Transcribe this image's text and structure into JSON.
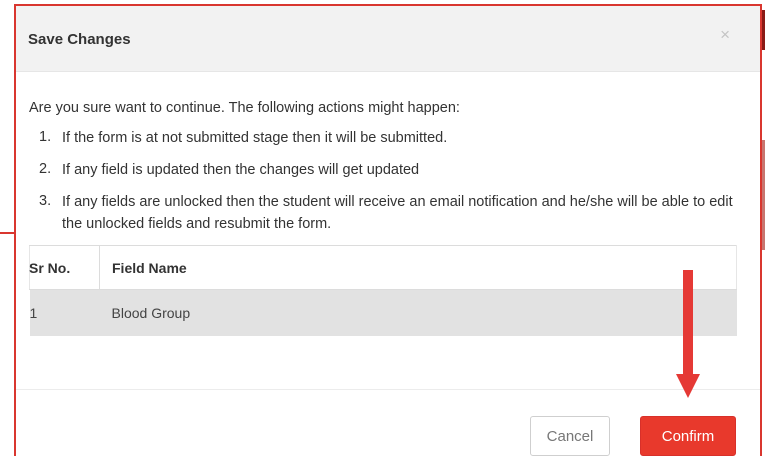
{
  "dialog": {
    "title": "Save Changes",
    "close_symbol": "×",
    "intro": "Are you sure want to continue. The following actions might happen:",
    "actions": [
      {
        "num": "1.",
        "text": "If the form is at not submitted stage then it will be submitted."
      },
      {
        "num": "2.",
        "text": "If any field is updated then the changes will get updated"
      },
      {
        "num": "3.",
        "text": "If any fields are unlocked then the student will receive an email notification and he/she will be able to edit the unlocked fields and resubmit the form."
      }
    ],
    "table": {
      "headers": [
        "Sr No.",
        "Field Name"
      ],
      "rows": [
        {
          "sr": "1",
          "field": "Blood Group"
        }
      ]
    },
    "buttons": {
      "cancel": "Cancel",
      "confirm": "Confirm"
    }
  },
  "colors": {
    "accent": "#e8392c",
    "arrow": "#e53935",
    "border": "#d9362f",
    "header_bg": "#f2f2f2",
    "row_bg": "#e2e2e2"
  },
  "icons": {
    "close": "close-icon",
    "annotation": "down-arrow-annotation"
  }
}
